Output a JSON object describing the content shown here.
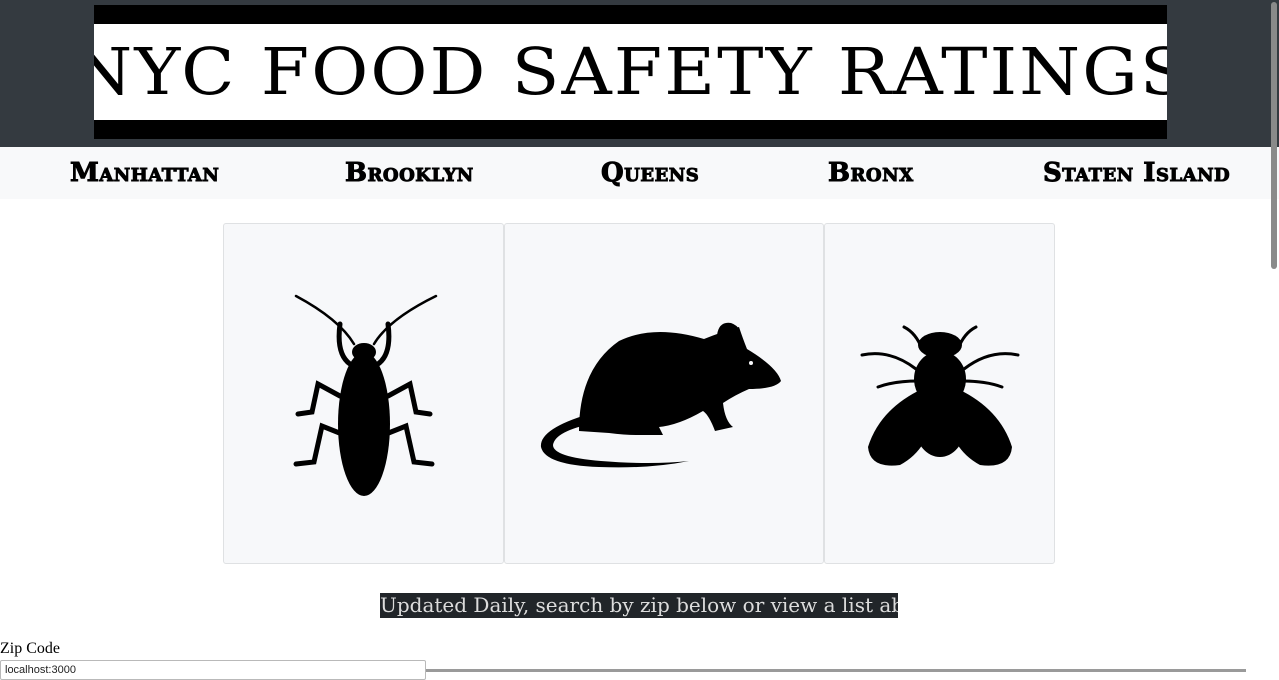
{
  "header": {
    "title": "NYC FOOD SAFETY RATINGS"
  },
  "nav": {
    "items": [
      {
        "label": "Manhattan"
      },
      {
        "label": "Brooklyn"
      },
      {
        "label": "Queens"
      },
      {
        "label": "Bronx"
      },
      {
        "label": "Staten Island"
      }
    ]
  },
  "cards": [
    {
      "icon": "cockroach-icon"
    },
    {
      "icon": "rat-icon"
    },
    {
      "icon": "fly-icon"
    }
  ],
  "tagline": "Updated Daily, search by zip below or view a list above",
  "zip_form": {
    "label": "Zip Code",
    "placeholder": "localhost:3000"
  },
  "colors": {
    "header_bg": "#343a40",
    "nav_bg": "#f8f9fa",
    "card_bg": "#f7f8fa",
    "tagline_bg": "#212529",
    "tagline_text": "#dcdcdc"
  }
}
